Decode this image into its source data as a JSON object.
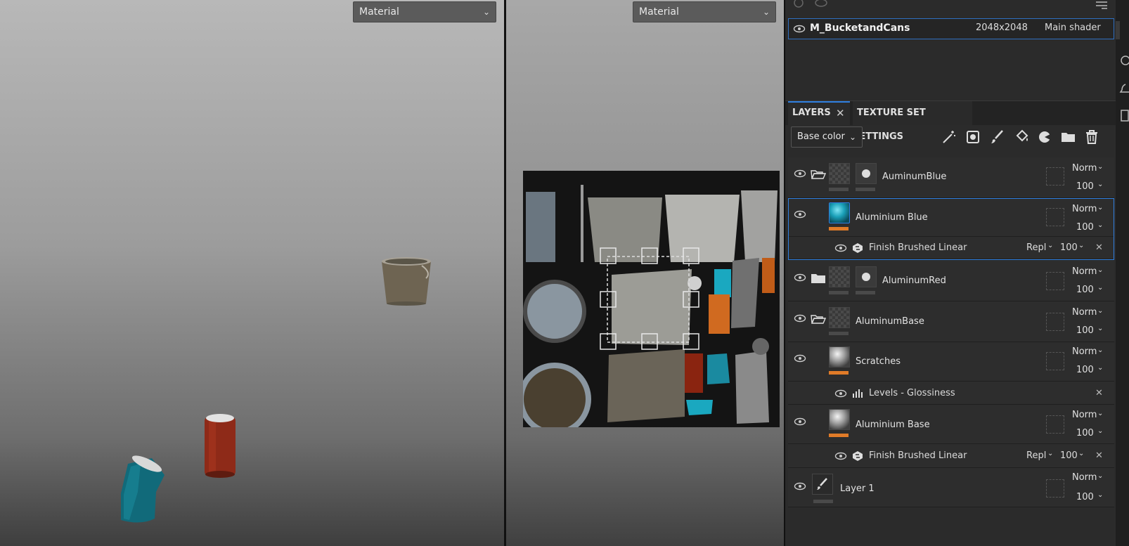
{
  "viewport3d": {
    "mode_dropdown": "Material"
  },
  "viewport2d": {
    "mode_dropdown": "Material"
  },
  "texture_set": {
    "name": "M_BucketandCans",
    "resolution": "2048x2048",
    "shader": "Main shader"
  },
  "tabs": {
    "layers": "LAYERS",
    "texture_set_settings": "TEXTURE SET SETTINGS"
  },
  "toolbar": {
    "channel_dropdown": "Base color"
  },
  "layers": [
    {
      "name": "AuminumBlue",
      "blend": "Norm",
      "opacity": "100"
    },
    {
      "name": "Aluminium Blue",
      "blend": "Norm",
      "opacity": "100"
    },
    {
      "name": "AluminumRed",
      "blend": "Norm",
      "opacity": "100"
    },
    {
      "name": "AluminumBase",
      "blend": "Norm",
      "opacity": "100"
    },
    {
      "name": "Scratches",
      "blend": "Norm",
      "opacity": "100"
    },
    {
      "name": "Aluminium Base",
      "blend": "Norm",
      "opacity": "100"
    },
    {
      "name": "Layer 1",
      "blend": "Norm",
      "opacity": "100"
    }
  ],
  "effects": [
    {
      "name": "Finish Brushed Linear",
      "blend": "Repl",
      "opacity": "100"
    },
    {
      "name": "Levels - Glossiness"
    },
    {
      "name": "Finish Brushed Linear",
      "blend": "Repl",
      "opacity": "100"
    }
  ],
  "colors": {
    "accent_blue": "#2f7fe0",
    "mask_orange": "#e07b28"
  }
}
